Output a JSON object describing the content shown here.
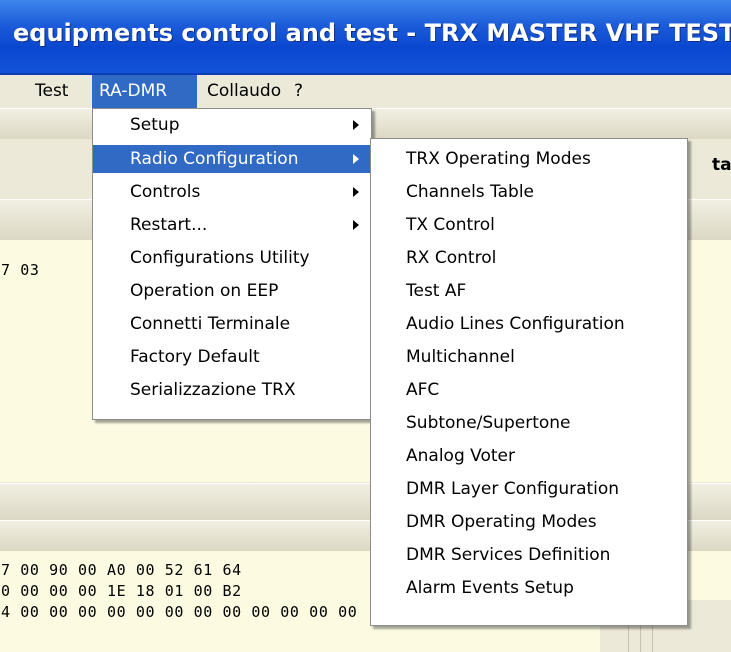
{
  "window": {
    "title": "equipments control and test - TRX MASTER VHF TEST"
  },
  "menubar": {
    "items": [
      {
        "label": "Test"
      },
      {
        "label": "RA-DMR"
      },
      {
        "label": "Collaudo"
      },
      {
        "label": "?"
      }
    ]
  },
  "background": {
    "header_fragment": "tal",
    "hex_line_top": "7 03",
    "hex_lines": [
      "7 00 90 00 A0 00 52 61 64",
      "0 00 00 00 1E 18 01 00 B2",
      "4 00 00 00 00 00 00 00 00 00 00 00 00"
    ]
  },
  "ra_dmr_menu": {
    "items": [
      {
        "label": "Setup",
        "submenu": true
      },
      {
        "label": "Radio Configuration",
        "submenu": true,
        "selected": true
      },
      {
        "label": "Controls",
        "submenu": true
      },
      {
        "label": "Restart...",
        "submenu": true
      },
      {
        "label": "Configurations Utility",
        "submenu": false
      },
      {
        "label": "Operation on EEP",
        "submenu": false
      },
      {
        "label": "Connetti Terminale",
        "submenu": false
      },
      {
        "label": "Factory Default",
        "submenu": false
      },
      {
        "label": "Serializzazione TRX",
        "submenu": false
      }
    ]
  },
  "radio_config_submenu": {
    "items": [
      {
        "label": "TRX Operating Modes"
      },
      {
        "label": "Channels Table"
      },
      {
        "label": "TX Control"
      },
      {
        "label": "RX Control"
      },
      {
        "label": "Test AF"
      },
      {
        "label": "Audio Lines Configuration"
      },
      {
        "label": "Multichannel"
      },
      {
        "label": "AFC"
      },
      {
        "label": "Subtone/Supertone"
      },
      {
        "label": "Analog Voter"
      },
      {
        "label": "DMR Layer Configuration"
      },
      {
        "label": "DMR Operating Modes"
      },
      {
        "label": "DMR Services Definition"
      },
      {
        "label": "Alarm Events Setup"
      }
    ]
  },
  "colors": {
    "titlebar": "#0a47d0",
    "selection": "#316ac5",
    "panel_cream": "#fcfbe2",
    "menubar": "#ece9d8"
  }
}
